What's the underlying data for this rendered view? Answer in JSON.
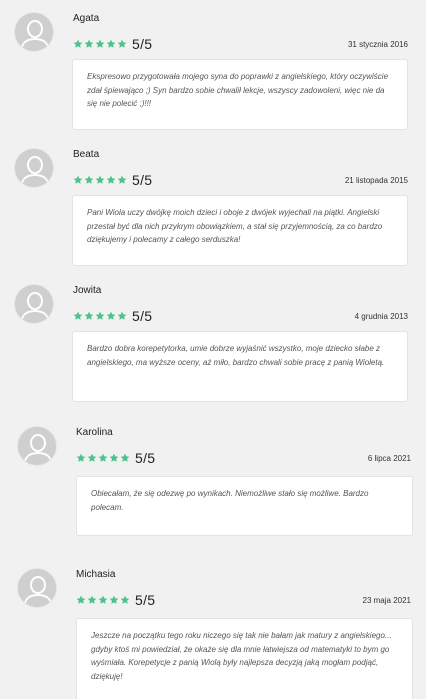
{
  "colors": {
    "star": "#4cc28d",
    "avatar_bg": "#cfcfcf",
    "avatar_fg": "#ffffff"
  },
  "icons": {
    "star": "star-icon",
    "avatar": "user-avatar-icon"
  },
  "reviews": [
    {
      "name": "Agata",
      "score": "5/5",
      "stars": 5,
      "date": "31 stycznia 2016",
      "text": "Ekspresowo przygotowała mojego syna do poprawki z angielskiego, który oczywiście zdał śpiewająco ;) Syn bardzo sobie chwalił lekcje, wszyscy zadowoleni, więc nie da się nie polecić ;)!!!"
    },
    {
      "name": "Beata",
      "score": "5/5",
      "stars": 5,
      "date": "21 listopada 2015",
      "text": "Pani Wiola uczy dwójkę moich dzieci i oboje z dwójek wyjechali na piątki. Angielski przestał być dla nich przykrym obowiązkiem, a stał się przyjemnością, za co bardzo dziękujemy i polecamy z całego serduszka!"
    },
    {
      "name": "Jowita",
      "score": "5/5",
      "stars": 5,
      "date": "4 grudnia 2013",
      "text": "Bardzo dobra korepetytorka, umie dobrze wyjaśnić wszystko, moje dziecko słabe z angielskiego, ma wyższe oceny, aż miło, bardzo chwali sobie pracę z panią Wioletą."
    },
    {
      "name": "Karolina",
      "score": "5/5",
      "stars": 5,
      "date": "6 lipca 2021",
      "text": "Obiecałam, że się odezwę po wynikach. Niemożliwe stało się możliwe. Bardzo polecam."
    },
    {
      "name": "Michasia",
      "score": "5/5",
      "stars": 5,
      "date": "23 maja 2021",
      "text": "Jeszcze na początku tego roku niczego się tak nie bałam jak matury z angielskiego... gdyby ktoś mi powiedział, że okaże się dla mnie łatwiejsza od matematyki to bym go wyśmiała. Korepetycje z panią Wiolą były najlepsza decyzją jaką mogłam podjąć, dziękuję!"
    }
  ]
}
